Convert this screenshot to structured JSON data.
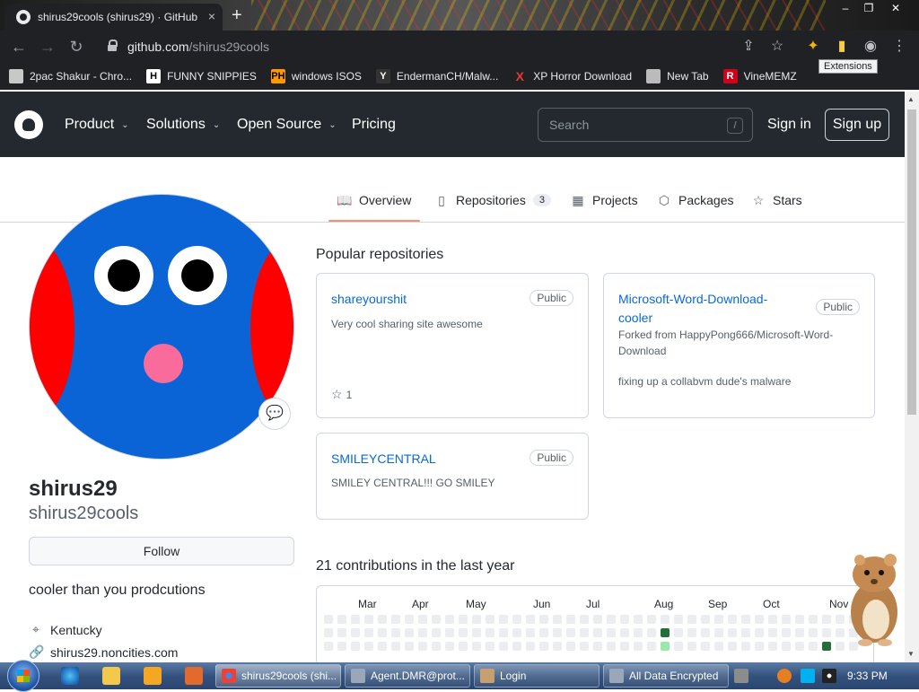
{
  "browser": {
    "tab_title": "shirus29cools (shirus29) · GitHub",
    "tab_close": "×",
    "new_tab": "+",
    "url_host": "github.com",
    "url_path": "/shirus29cools",
    "tooltip": "Extensions",
    "bookmarks": [
      {
        "label": "2pac Shakur - Chro...",
        "icon_color": "#c8c8c8",
        "icon_text": ""
      },
      {
        "label": "FUNNY SNIPPIES",
        "icon_color": "#ffffff",
        "icon_text": "H"
      },
      {
        "label": "windows ISOS",
        "icon_color": "#ff9900",
        "icon_text": "PH"
      },
      {
        "label": "EndermanCH/Malw...",
        "icon_color": "#333333",
        "icon_text": "Y"
      },
      {
        "label": "XP Horror Download",
        "icon_color": "#202124",
        "icon_text": "X"
      },
      {
        "label": "New Tab",
        "icon_color": "#bbbbbb",
        "icon_text": ""
      },
      {
        "label": "VineMEMZ",
        "icon_color": "#d0021b",
        "icon_text": "R"
      }
    ]
  },
  "header": {
    "nav": [
      {
        "label": "Product",
        "chevron": "⌄"
      },
      {
        "label": "Solutions",
        "chevron": "⌄"
      },
      {
        "label": "Open Source",
        "chevron": "⌄"
      },
      {
        "label": "Pricing",
        "chevron": ""
      }
    ],
    "search_placeholder": "Search",
    "search_shortcut": "/",
    "signin": "Sign in",
    "signup": "Sign up"
  },
  "profile_tabs": [
    {
      "label": "Overview",
      "icon": "book-icon",
      "glyph": "📖",
      "count": ""
    },
    {
      "label": "Repositories",
      "icon": "repo-icon",
      "glyph": "▯",
      "count": "3"
    },
    {
      "label": "Projects",
      "icon": "table-icon",
      "glyph": "▦",
      "count": ""
    },
    {
      "label": "Packages",
      "icon": "package-icon",
      "glyph": "⬡",
      "count": ""
    },
    {
      "label": "Stars",
      "icon": "star-icon",
      "glyph": "☆",
      "count": ""
    }
  ],
  "profile": {
    "name": "shirus29",
    "login": "shirus29cools",
    "follow": "Follow",
    "bio": "cooler than you prodcutions",
    "location": "Kentucky",
    "website": "shirus29.noncities.com"
  },
  "popular": {
    "title": "Popular repositories",
    "repos": [
      {
        "name": "shareyourshit",
        "visibility": "Public",
        "description": "Very cool sharing site awesome",
        "forked_from": "",
        "stars": "1"
      },
      {
        "name": "Microsoft-Word-Download-cooler",
        "visibility": "Public",
        "description": "fixing up a collabvm dude's malware",
        "forked_from": "Forked from HappyPong666/Microsoft-Word-Download",
        "stars": ""
      },
      {
        "name": "SMILEYCENTRAL",
        "visibility": "Public",
        "description": "SMILEY CENTRAL!!! GO SMILEY",
        "forked_from": "",
        "stars": ""
      }
    ]
  },
  "contributions": {
    "title": "21 contributions in the last year",
    "months": [
      "Mar",
      "Apr",
      "May",
      "Jun",
      "Jul",
      "Aug",
      "Sep",
      "Oct",
      "Nov"
    ]
  },
  "taskbar": {
    "tasks": [
      {
        "label": "shirus29cools (shi...",
        "active": true,
        "icon_color": "#e84c3d"
      },
      {
        "label": "Agent.DMR@prot...",
        "active": false,
        "icon_color": "#9aa7b8"
      },
      {
        "label": "Login",
        "active": false,
        "icon_color": "#c8a070"
      },
      {
        "label": "All Data Encrypted",
        "active": false,
        "icon_color": "#9aa7b8"
      }
    ],
    "clock": "9:33 PM"
  },
  "colors": {
    "gh_header": "#24292f",
    "link": "#0969da",
    "avatar_blue": "#0b64d6",
    "avatar_red": "#ff0000",
    "contrib_dark": "#216e39",
    "contrib_light": "#9be9a8"
  }
}
